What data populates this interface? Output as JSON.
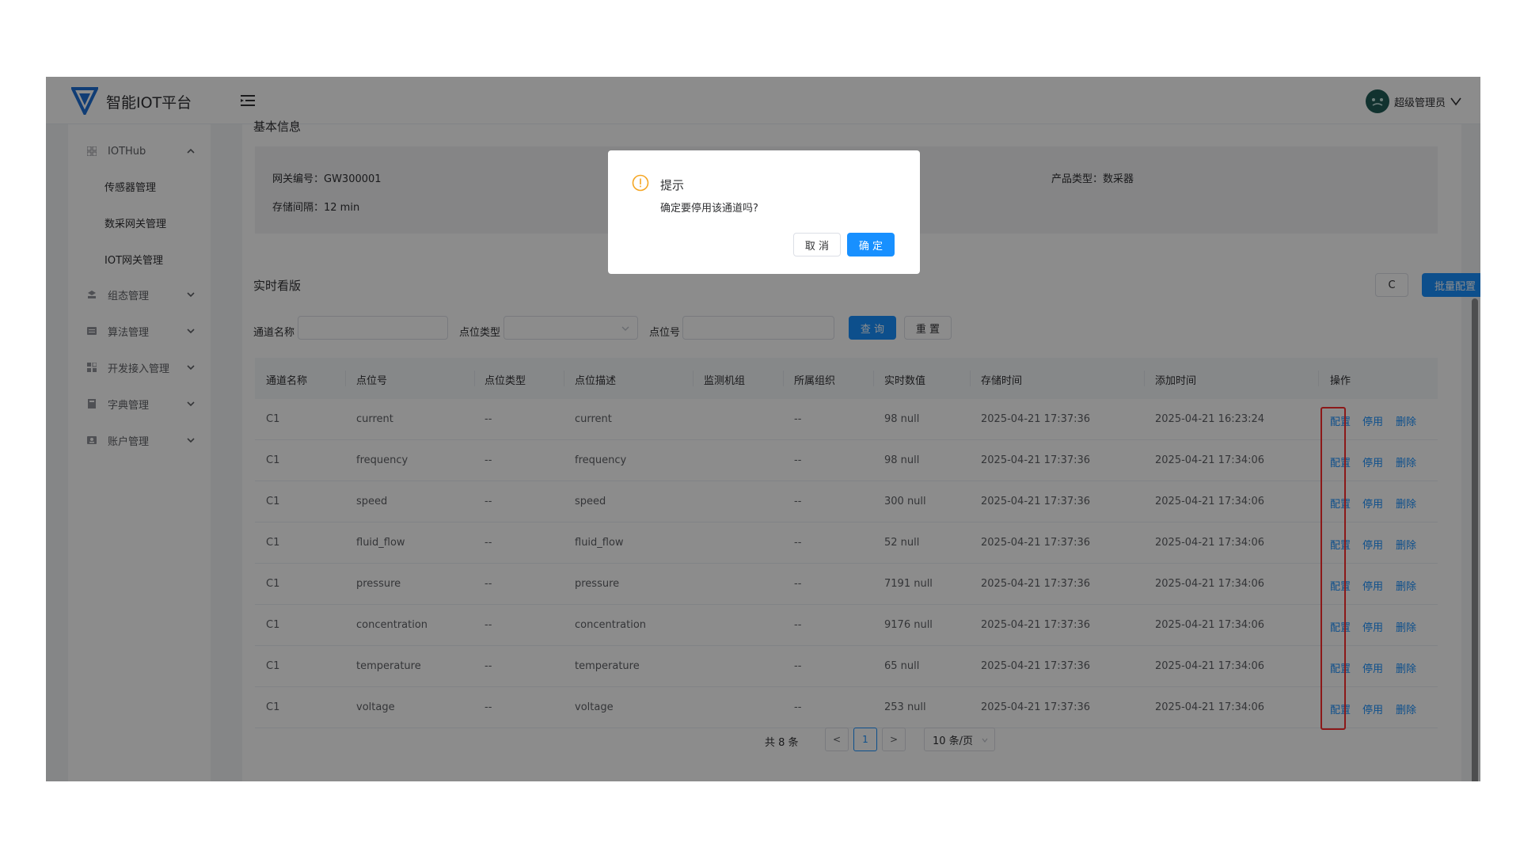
{
  "app": {
    "title": "智能IOT平台"
  },
  "user": {
    "name": "超级管理员"
  },
  "sidebar": {
    "items": [
      {
        "label": "IOTHub",
        "icon": "grid-icon",
        "expanded": true
      },
      {
        "label": "组态管理",
        "icon": "layers-icon",
        "expanded": false
      },
      {
        "label": "算法管理",
        "icon": "list-icon",
        "expanded": false
      },
      {
        "label": "开发接入管理",
        "icon": "apps-icon",
        "expanded": false
      },
      {
        "label": "字典管理",
        "icon": "book-icon",
        "expanded": false
      },
      {
        "label": "账户管理",
        "icon": "user-card-icon",
        "expanded": false
      }
    ],
    "sub_items": [
      "传感器管理",
      "数采网关管理",
      "IOT网关管理"
    ]
  },
  "basic_info": {
    "heading": "基本信息",
    "gateway_no": "网关编号：GW300001",
    "storage_interval": "存储间隔：12 min",
    "product_type": "产品类型：数采器"
  },
  "board": {
    "title": "实时看版",
    "refresh_label": "C",
    "batch_label": "批量配置"
  },
  "filters": {
    "channel_name_label": "通道名称",
    "point_type_label": "点位类型",
    "point_no_label": "点位号",
    "query_label": "查 询",
    "reset_label": "重 置"
  },
  "table": {
    "headers": [
      "通道名称",
      "点位号",
      "点位类型",
      "点位描述",
      "监测机组",
      "所属组织",
      "实时数值",
      "存储时间",
      "添加时间",
      "操作"
    ],
    "rows": [
      [
        "C1",
        "current",
        "--",
        "current",
        "",
        "--",
        "98 null",
        "2025-04-21 17:37:36",
        "2025-04-21 16:23:24"
      ],
      [
        "C1",
        "frequency",
        "--",
        "frequency",
        "",
        "--",
        "98 null",
        "2025-04-21 17:37:36",
        "2025-04-21 17:34:06"
      ],
      [
        "C1",
        "speed",
        "--",
        "speed",
        "",
        "--",
        "300 null",
        "2025-04-21 17:37:36",
        "2025-04-21 17:34:06"
      ],
      [
        "C1",
        "fluid_flow",
        "--",
        "fluid_flow",
        "",
        "--",
        "52 null",
        "2025-04-21 17:37:36",
        "2025-04-21 17:34:06"
      ],
      [
        "C1",
        "pressure",
        "--",
        "pressure",
        "",
        "--",
        "7191 null",
        "2025-04-21 17:37:36",
        "2025-04-21 17:34:06"
      ],
      [
        "C1",
        "concentration",
        "--",
        "concentration",
        "",
        "--",
        "9176 null",
        "2025-04-21 17:37:36",
        "2025-04-21 17:34:06"
      ],
      [
        "C1",
        "temperature",
        "--",
        "temperature",
        "",
        "--",
        "65 null",
        "2025-04-21 17:37:36",
        "2025-04-21 17:34:06"
      ],
      [
        "C1",
        "voltage",
        "--",
        "voltage",
        "",
        "--",
        "253 null",
        "2025-04-21 17:37:36",
        "2025-04-21 17:34:06"
      ]
    ],
    "actions": {
      "config": "配置",
      "disable": "停用",
      "delete": "删除"
    }
  },
  "pagination": {
    "total": "共 8 条",
    "prev": "<",
    "current_page": "1",
    "next": ">",
    "page_size": "10 条/页"
  },
  "dialog": {
    "title": "提示",
    "message": "确定要停用该通道吗?",
    "cancel": "取 消",
    "confirm": "确 定"
  },
  "colors": {
    "primary": "#1890ff",
    "warning": "#f5a623",
    "highlight": "#ff2d2d"
  }
}
